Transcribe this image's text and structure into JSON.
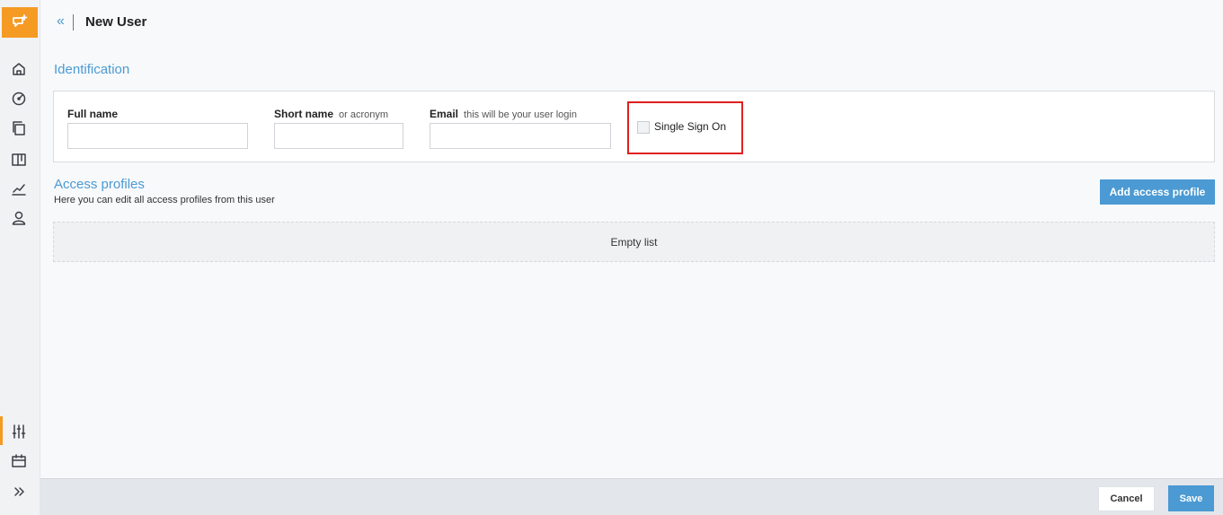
{
  "header": {
    "title": "New User",
    "back_icon": "chevron-double-left-icon"
  },
  "sidebar": {
    "logo_icon": "app-logo-icon",
    "items": [
      {
        "icon": "home-icon"
      },
      {
        "icon": "gauge-icon"
      },
      {
        "icon": "documents-icon"
      },
      {
        "icon": "board-icon"
      },
      {
        "icon": "chart-icon"
      },
      {
        "icon": "user-icon"
      },
      {
        "icon": "sliders-icon"
      },
      {
        "icon": "calendar-icon"
      },
      {
        "icon": "expand-icon"
      }
    ]
  },
  "identification": {
    "title": "Identification",
    "full_name": {
      "label": "Full name",
      "value": ""
    },
    "short_name": {
      "label": "Short name",
      "hint": "or acronym",
      "value": ""
    },
    "email": {
      "label": "Email",
      "hint": "this will be your user login",
      "value": ""
    },
    "sso": {
      "label": "Single Sign On",
      "checked": false
    }
  },
  "access_profiles": {
    "title": "Access profiles",
    "subtitle": "Here you can edit all access profiles from this user",
    "add_button": "Add access profile",
    "empty_text": "Empty list"
  },
  "footer": {
    "cancel_label": "Cancel",
    "save_label": "Save"
  },
  "colors": {
    "accent": "#4b9ad3",
    "brand": "#f59a23",
    "highlight": "#e02020"
  }
}
